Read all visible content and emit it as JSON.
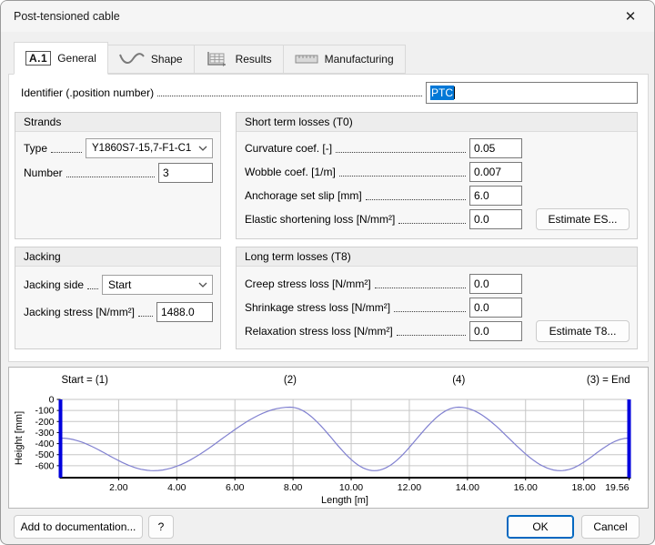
{
  "window": {
    "title": "Post-tensioned cable",
    "close_glyph": "✕"
  },
  "tabs": [
    {
      "label": "General",
      "badge": "A.1",
      "active": true
    },
    {
      "label": "Shape",
      "active": false
    },
    {
      "label": "Results",
      "active": false
    },
    {
      "label": "Manufacturing",
      "active": false
    }
  ],
  "identifier": {
    "label": "Identifier (.position number)",
    "value": "PTC"
  },
  "strands": {
    "title": "Strands",
    "type_label": "Type",
    "type_value": "Y1860S7-15,7-F1-C1",
    "number_label": "Number",
    "number_value": "3"
  },
  "short_term": {
    "title": "Short term losses (T0)",
    "rows": [
      {
        "label": "Curvature coef. [-]",
        "value": "0.05"
      },
      {
        "label": "Wobble coef. [1/m]",
        "value": "0.007"
      },
      {
        "label": "Anchorage set slip [mm]",
        "value": "6.0"
      },
      {
        "label": "Elastic shortening loss [N/mm²]",
        "value": "0.0",
        "button": "Estimate ES..."
      }
    ]
  },
  "jacking": {
    "title": "Jacking",
    "side_label": "Jacking side",
    "side_value": "Start",
    "stress_label": "Jacking stress [N/mm²]",
    "stress_value": "1488.0"
  },
  "long_term": {
    "title": "Long term losses (T8)",
    "rows": [
      {
        "label": "Creep stress loss [N/mm²]",
        "value": "0.0"
      },
      {
        "label": "Shrinkage stress loss [N/mm²]",
        "value": "0.0"
      },
      {
        "label": "Relaxation stress loss [N/mm²]",
        "value": "0.0",
        "button": "Estimate T8..."
      }
    ]
  },
  "chart_data": {
    "type": "line",
    "title": "",
    "xlabel": "Length [m]",
    "ylabel": "Height [mm]",
    "xlim": [
      0,
      19.56
    ],
    "ylim": [
      -700,
      0
    ],
    "x_ticks": [
      2,
      4,
      6,
      8,
      10,
      12,
      14,
      16,
      18,
      19.56
    ],
    "x_tick_labels": [
      "2.00",
      "4.00",
      "6.00",
      "8.00",
      "10.00",
      "12.00",
      "14.00",
      "16.00",
      "18.00",
      "19.56"
    ],
    "y_ticks": [
      0,
      -100,
      -200,
      -300,
      -400,
      -500,
      -600
    ],
    "grid": true,
    "legend": "none",
    "anchor_labels": [
      {
        "text": "Start = (1)",
        "x": 0,
        "align": "start"
      },
      {
        "text": "(2)",
        "x": 7.9,
        "align": "middle"
      },
      {
        "text": "(4)",
        "x": 13.7,
        "align": "middle"
      },
      {
        "text": "(3) = End",
        "x": 19.56,
        "align": "end"
      }
    ],
    "series": [
      {
        "name": "cable-height-profile",
        "interpolation": "cosine",
        "key_points": [
          [
            0,
            -350
          ],
          [
            3.2,
            -645
          ],
          [
            7.9,
            -70
          ],
          [
            10.8,
            -645
          ],
          [
            13.7,
            -70
          ],
          [
            17.2,
            -645
          ],
          [
            19.56,
            -350
          ]
        ]
      }
    ],
    "curve_color": "#8080d0",
    "anchor_bar_color": "#0000dd",
    "grid_color": "#c6c6c6",
    "axis_color": "#000000"
  },
  "footer": {
    "add_doc": "Add to documentation...",
    "help": "?",
    "ok": "OK",
    "cancel": "Cancel"
  }
}
